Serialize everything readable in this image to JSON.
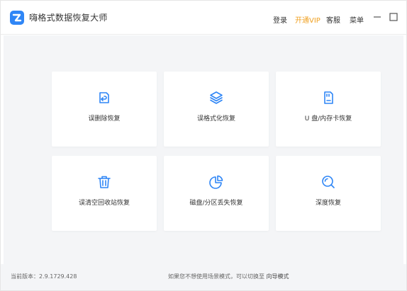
{
  "app": {
    "title": "嗨格式数据恢复大师",
    "logo_icon": "app-logo-icon",
    "brand_color": "#2f86f6"
  },
  "topnav": {
    "login": "登录",
    "vip": "开通VIP",
    "vip_color": "#f0a020",
    "service": "客服",
    "menu": "菜单"
  },
  "cards": [
    {
      "label": "误删除恢复",
      "icon": "undo-delete-icon"
    },
    {
      "label": "误格式化恢复",
      "icon": "layers-icon"
    },
    {
      "label": "U 盘/内存卡恢复",
      "icon": "sd-card-icon"
    },
    {
      "label": "误清空回收站恢复",
      "icon": "trash-icon"
    },
    {
      "label": "磁盘/分区丢失恢复",
      "icon": "pie-chart-icon"
    },
    {
      "label": "深度恢复",
      "icon": "deep-search-icon"
    }
  ],
  "footer": {
    "version": "当前版本：2.9.1729.428",
    "hint": "如果您不想使用场景模式，可以切换至",
    "wizard_link": "向导模式"
  },
  "accent_color": "#2f86f6"
}
